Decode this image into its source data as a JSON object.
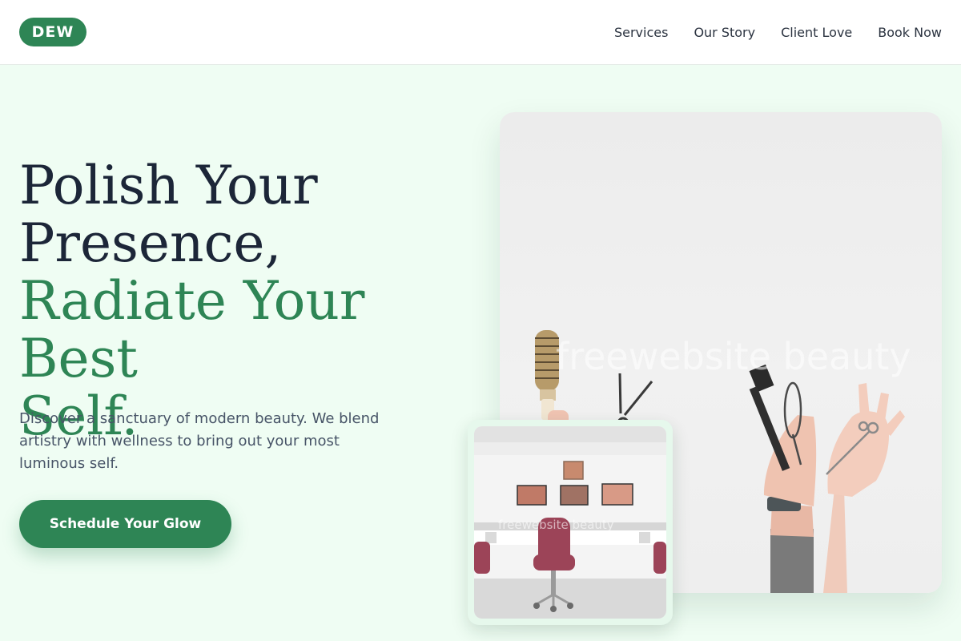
{
  "header": {
    "logo": "DEW",
    "nav": [
      "Services",
      "Our Story",
      "Client Love",
      "Book Now"
    ]
  },
  "hero": {
    "headline_dark": [
      "Polish Your",
      "Presence,"
    ],
    "headline_green": [
      "Radiate Your Best",
      "Self."
    ],
    "description": "Discover a sanctuary of modern beauty. We blend artistry with wellness to bring out your most luminous self.",
    "cta_label": "Schedule Your Glow"
  },
  "images": {
    "main_watermark": "freewebsite beauty",
    "inset_watermark": "freewebsite beauty"
  },
  "colors": {
    "brand": "#2e8555",
    "heading": "#1c2638",
    "background": "#effdf3"
  }
}
